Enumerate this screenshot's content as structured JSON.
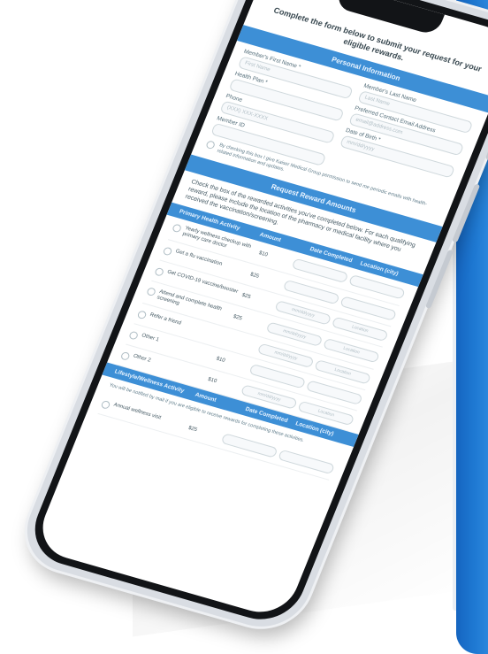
{
  "form": {
    "intro": "Complete the form below to submit your request for your eligible rewards.",
    "personal_section": "Personal Information",
    "fields": [
      {
        "label": "Member's First Name *",
        "placeholder": "First Name"
      },
      {
        "label": "Member's Last Name",
        "placeholder": "Last Name"
      },
      {
        "label": "Health Plan *",
        "placeholder": ""
      },
      {
        "label": "Preferred Contact Email Address",
        "placeholder": "email@address.com"
      },
      {
        "label": "Phone",
        "placeholder": "(XXX) XXX-XXXX"
      },
      {
        "label": "Date of Birth *",
        "placeholder": "mm/dd/yyyy"
      },
      {
        "label": "Member ID",
        "placeholder": ""
      }
    ],
    "consent": "By checking this box I give Kaiser Medical Group permission to send me periodic emails with health-related information and updates.",
    "request_section": "Request Reward Amounts",
    "instructions": "Check the box of the rewarded activities you've completed below. For each qualifying reward, please include the location of the pharmacy or medical facility where you received the vaccination/screening.",
    "table_headers": [
      "Primary Health Activity",
      "Amount",
      "Date Completed",
      "Location (city)"
    ],
    "rows": [
      {
        "desc": "Yearly wellness checkup with primary care doctor",
        "amount": "$10",
        "date": "",
        "location": ""
      },
      {
        "desc": "Get a flu vaccination",
        "amount": "$25",
        "date": "",
        "location": ""
      },
      {
        "desc": "Get COVID-19 vaccine/booster",
        "amount": "$25",
        "date": "mm/dd/yyyy",
        "location": "Location"
      },
      {
        "desc": "Attend and complete health screening",
        "amount": "$25",
        "date": "mm/dd/yyyy",
        "location": "Location"
      },
      {
        "desc": "Refer a friend",
        "amount": "",
        "date": "mm/dd/yyyy",
        "location": "Location"
      },
      {
        "desc": "Other 1",
        "amount": "$10",
        "date": "",
        "location": ""
      },
      {
        "desc": "Other 2",
        "amount": "$10",
        "date": "mm/dd/yyyy",
        "location": "Location"
      }
    ],
    "table2_headers": [
      "Lifestyle/Wellness Activity",
      "Amount",
      "Date Completed",
      "Location (city)"
    ],
    "table2_note": "You will be notified by mail if you are eligible to receive rewards for completing these activities.",
    "row_last": {
      "desc": "Annual wellness visit",
      "amount": "$25"
    }
  }
}
